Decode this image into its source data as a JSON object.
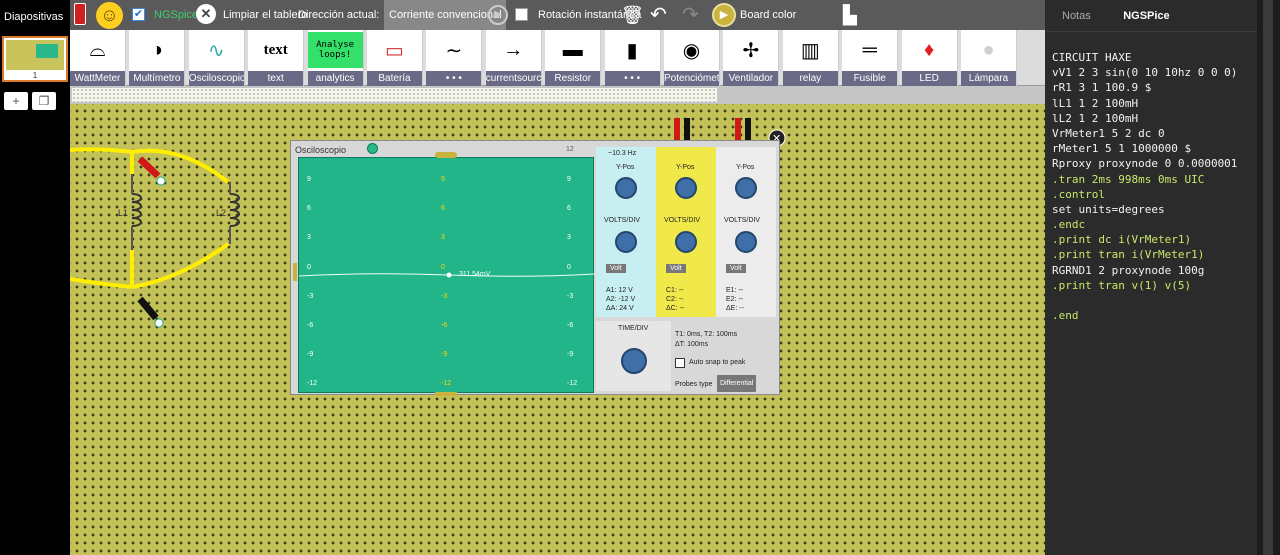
{
  "sidebar": {
    "title": "Diapositivas",
    "slide_number": "1",
    "add_slide_icon": "plus-icon",
    "copy_slide_icon": "copy-icon"
  },
  "toolbar": {
    "ngspice_label": "NGSpice",
    "clear_label": "Limpiar el tablero",
    "direction_label": "Dirección actual:",
    "direction_value": "Corriente convencional",
    "rotation_label": "Rotación instantánea",
    "board_color_label": "Board color"
  },
  "parts": [
    {
      "label": "WattMeter",
      "icon": "wattmeter-icon",
      "glyph": "⌓"
    },
    {
      "label": "Multímetro",
      "icon": "multimeter-icon",
      "glyph": "◑"
    },
    {
      "label": "Osciloscopio",
      "icon": "oscilloscope-icon",
      "glyph": "∿"
    },
    {
      "label": "text",
      "icon": "text-icon",
      "glyph": "text"
    },
    {
      "label": "analytics",
      "icon": "analytics-icon",
      "glyph": "Analyse loops!"
    },
    {
      "label": "Batería",
      "icon": "battery-icon",
      "glyph": "▭"
    },
    {
      "label": "• • •",
      "icon": "ac-source-icon",
      "glyph": "∼"
    },
    {
      "label": "currentsource",
      "icon": "current-source-icon",
      "glyph": "→"
    },
    {
      "label": "Resistor",
      "icon": "resistor-icon",
      "glyph": "▬"
    },
    {
      "label": "• • •",
      "icon": "switch-icon",
      "glyph": "▮"
    },
    {
      "label": "Potenciómetro",
      "icon": "potentiometer-icon",
      "glyph": "◉"
    },
    {
      "label": "Ventilador",
      "icon": "fan-icon",
      "glyph": "✢"
    },
    {
      "label": "relay",
      "icon": "relay-icon",
      "glyph": "▥"
    },
    {
      "label": "Fusible",
      "icon": "fuse-icon",
      "glyph": "═"
    },
    {
      "label": "LED",
      "icon": "led-icon",
      "glyph": "♦"
    },
    {
      "label": "Lámpara",
      "icon": "lamp-icon",
      "glyph": "●"
    }
  ],
  "oscilloscope": {
    "title": "Osciloscopio",
    "channel_a_freq": "~10.3 Hz",
    "ypos_label": "Y-Pos",
    "voltsdiv_label": "VOLTS/DIV",
    "volt_btn": "Volt",
    "trace_label": "311.54mV",
    "a_readings": [
      "A1: 12 V",
      "A2: -12 V",
      "ΔA: 24 V"
    ],
    "c_readings": [
      "C1: --",
      "C2: --",
      "ΔC: --"
    ],
    "e_readings": [
      "E1: --",
      "E2: --",
      "ΔE: --"
    ],
    "timediv_label": "TIME/DIV",
    "t_readings": [
      "T1: 0ms, T2: 100ms",
      "ΔT: 100ms"
    ],
    "snap_label": "Auto snap to peak",
    "probes_label": "Probes type",
    "probes_value": "Differential",
    "y_ticks": [
      "9",
      "6",
      "3",
      "0",
      "-3",
      "-6",
      "-9",
      "-12"
    ],
    "corner_label": "12"
  },
  "right_panel": {
    "tabs": [
      "Notas",
      "NGSPice"
    ],
    "code_lines": [
      "CIRCUIT HAXE",
      "vV1 2 3 sin(0 10 10hz 0 0 0)",
      "rR1 3 1 100.9 $",
      "lL1 1 2 100mH",
      "lL2 1 2 100mH",
      "VrMeter1 5 2 dc 0",
      "rMeter1 5 1 1000000 $",
      "Rproxy proxynode 0 0.0000001",
      ".tran 2ms 998ms 0ms UIC",
      ".control",
      "set units=degrees",
      ".endc",
      ".print dc i(VrMeter1)",
      ".print tran i(VrMeter1)",
      "RGRND1 2 proxynode 100g",
      ".print tran v(1) v(5)",
      "",
      ".end"
    ]
  },
  "colors": {
    "board": "#c3c259",
    "scope_screen": "#22b58a",
    "wire": "#ffee00",
    "code_bg": "#2b2b2b"
  }
}
